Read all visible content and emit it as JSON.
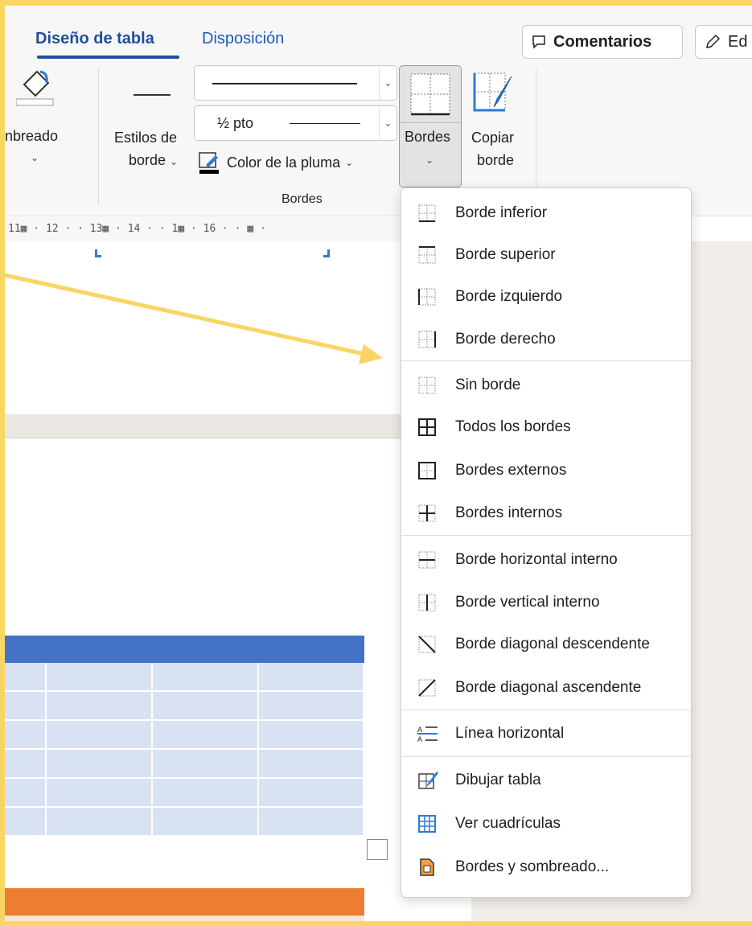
{
  "tabs": {
    "active": "Diseño de tabla",
    "second": "Disposición",
    "comments": "Comentarios",
    "edit": "Ed"
  },
  "ribbon": {
    "shading_label": "nbreado",
    "border_styles_line1": "Estilos de",
    "border_styles_line2": "borde",
    "pen_weight": "½ pto",
    "pen_color": "Color de la pluma",
    "borders_line1": "Bordes",
    "copy_border_line1": "Copiar",
    "copy_border_line2": "borde",
    "group_label": "Bordes"
  },
  "ruler": {
    "text": "11▦ · 12 · · 13▦ · 14 · · 1▦ · 16 · · ▦ ·"
  },
  "menu": {
    "items": [
      {
        "label": "Borde inferior",
        "icon": "border-bottom-icon"
      },
      {
        "label": "Borde superior",
        "icon": "border-top-icon"
      },
      {
        "label": "Borde izquierdo",
        "icon": "border-left-icon"
      },
      {
        "label": "Borde derecho",
        "icon": "border-right-icon"
      },
      {
        "label": "Sin borde",
        "icon": "no-border-icon"
      },
      {
        "label": "Todos los bordes",
        "icon": "all-borders-icon"
      },
      {
        "label": "Bordes externos",
        "icon": "outside-borders-icon"
      },
      {
        "label": "Bordes internos",
        "icon": "inside-borders-icon"
      },
      {
        "label": "Borde horizontal interno",
        "icon": "inside-horizontal-border-icon"
      },
      {
        "label": "Borde vertical interno",
        "icon": "inside-vertical-border-icon"
      },
      {
        "label": "Borde diagonal descendente",
        "icon": "diagonal-down-border-icon"
      },
      {
        "label": "Borde diagonal ascendente",
        "icon": "diagonal-up-border-icon"
      },
      {
        "label": "Línea horizontal",
        "icon": "horizontal-line-icon"
      },
      {
        "label": "Dibujar tabla",
        "icon": "draw-table-icon"
      },
      {
        "label": "Ver cuadrículas",
        "icon": "view-gridlines-icon"
      },
      {
        "label": "Bordes y sombreado...",
        "icon": "borders-shading-icon"
      }
    ]
  },
  "colors": {
    "accent_yellow": "#f9d663",
    "table_header_blue": "#4472c4",
    "table_cell_blue": "#d9e2f3",
    "table_header_orange": "#ed7d31"
  }
}
